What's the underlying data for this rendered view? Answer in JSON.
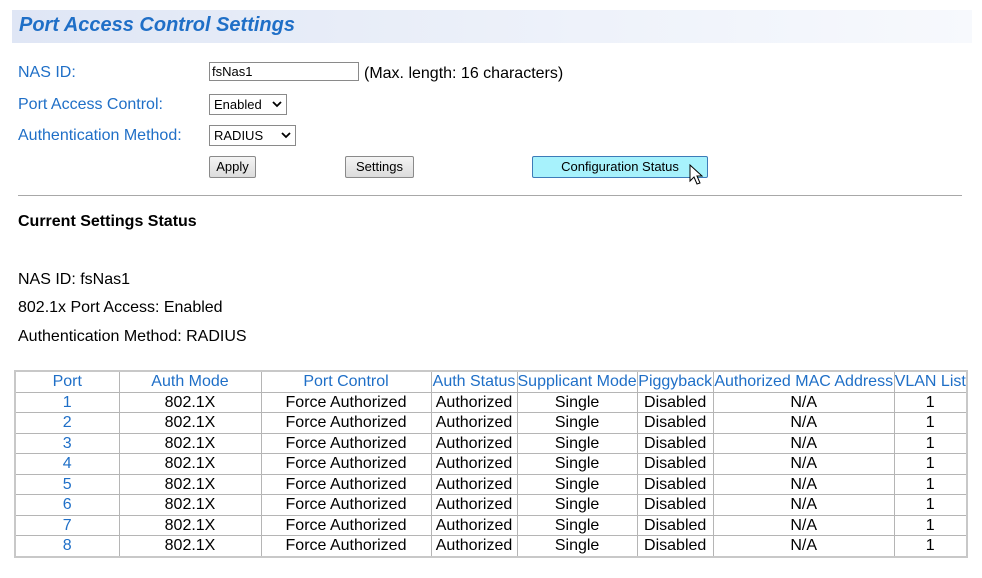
{
  "page": {
    "title": "Port Access Control Settings"
  },
  "form": {
    "nas_id": {
      "label": "NAS ID:",
      "value": "fsNas1",
      "hint": "(Max. length: 16 characters)"
    },
    "port_access_control": {
      "label": "Port Access Control:",
      "selected": "Enabled"
    },
    "auth_method": {
      "label": "Authentication Method:",
      "selected": "RADIUS"
    },
    "buttons": {
      "apply": "Apply",
      "settings": "Settings",
      "config_status": "Configuration Status"
    }
  },
  "current_status": {
    "title": "Current Settings Status",
    "nas_id_line": "NAS ID: fsNas1",
    "port_access_line": "802.1x Port Access: Enabled",
    "auth_method_line": "Authentication Method: RADIUS"
  },
  "table": {
    "headers": [
      "Port",
      "Auth Mode",
      "Port Control",
      "Auth Status",
      "Supplicant Mode",
      "Piggyback",
      "Authorized MAC Address",
      "VLAN List"
    ],
    "rows": [
      [
        "1",
        "802.1X",
        "Force Authorized",
        "Authorized",
        "Single",
        "Disabled",
        "N/A",
        "1"
      ],
      [
        "2",
        "802.1X",
        "Force Authorized",
        "Authorized",
        "Single",
        "Disabled",
        "N/A",
        "1"
      ],
      [
        "3",
        "802.1X",
        "Force Authorized",
        "Authorized",
        "Single",
        "Disabled",
        "N/A",
        "1"
      ],
      [
        "4",
        "802.1X",
        "Force Authorized",
        "Authorized",
        "Single",
        "Disabled",
        "N/A",
        "1"
      ],
      [
        "5",
        "802.1X",
        "Force Authorized",
        "Authorized",
        "Single",
        "Disabled",
        "N/A",
        "1"
      ],
      [
        "6",
        "802.1X",
        "Force Authorized",
        "Authorized",
        "Single",
        "Disabled",
        "N/A",
        "1"
      ],
      [
        "7",
        "802.1X",
        "Force Authorized",
        "Authorized",
        "Single",
        "Disabled",
        "N/A",
        "1"
      ],
      [
        "8",
        "802.1X",
        "Force Authorized",
        "Authorized",
        "Single",
        "Disabled",
        "N/A",
        "1"
      ]
    ]
  },
  "colors": {
    "accent": "#1f6fc7",
    "active_button": "#a7f2fc"
  }
}
